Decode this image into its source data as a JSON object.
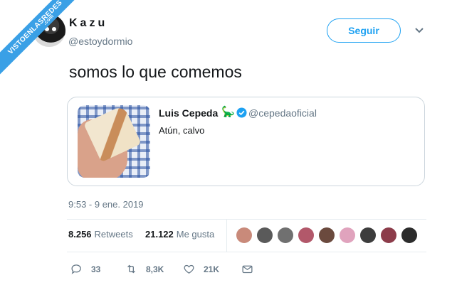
{
  "watermark": {
    "text": "VISTOENLASREDES",
    "suffix": ".com"
  },
  "author": {
    "display_name": "Kazu",
    "handle": "@estoydormio"
  },
  "follow_button": {
    "label": "Seguir"
  },
  "tweet": {
    "text": "somos lo que comemos",
    "timestamp": "9:53 - 9 ene. 2019"
  },
  "quoted_tweet": {
    "display_name": "Luis Cepeda",
    "emoji": "🦕",
    "handle": "@cepedaoficial",
    "text": "Atún, calvo"
  },
  "stats": {
    "retweets_count": "8.256",
    "retweets_label": "Retweets",
    "likes_count": "21.122",
    "likes_label": "Me gusta"
  },
  "actions": {
    "reply_count": "33",
    "retweet_count": "8,3K",
    "like_count": "21K"
  },
  "liker_avatars": [
    {
      "color": "#c98a7a"
    },
    {
      "color": "#5a5a5a"
    },
    {
      "color": "#707070"
    },
    {
      "color": "#b2586a"
    },
    {
      "color": "#6b4a3e"
    },
    {
      "color": "#e0a3bd"
    },
    {
      "color": "#3d3d3d"
    },
    {
      "color": "#8c3c4a"
    },
    {
      "color": "#2c2c2c"
    }
  ],
  "colors": {
    "accent": "#1da1f2",
    "muted": "#657786",
    "border": "#e6ecf0"
  }
}
